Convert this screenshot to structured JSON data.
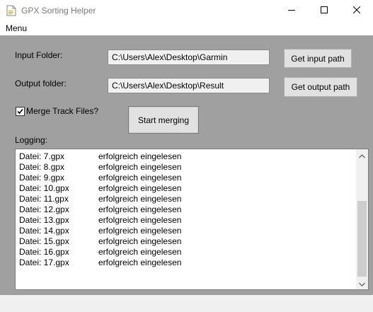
{
  "window": {
    "title": "GPX Sorting Helper"
  },
  "menubar": {
    "menu_label": "Menu"
  },
  "input": {
    "label": "Input Folder:",
    "value": "C:\\Users\\Alex\\Desktop\\Garmin",
    "button_label": "Get input path"
  },
  "output": {
    "label": "Output folder:",
    "value": "C:\\Users\\Alex\\Desktop\\Result",
    "button_label": "Get output path"
  },
  "merge": {
    "checkbox_label": "Merge Track Files?",
    "checked": true,
    "button_label": "Start merging"
  },
  "logging": {
    "label": "Logging:",
    "rows": [
      {
        "file": "Datei: 7.gpx",
        "status": "erfolgreich eingelesen"
      },
      {
        "file": "Datei: 8.gpx",
        "status": "erfolgreich eingelesen"
      },
      {
        "file": "Datei: 9.gpx",
        "status": "erfolgreich eingelesen"
      },
      {
        "file": "Datei: 10.gpx",
        "status": "erfolgreich eingelesen"
      },
      {
        "file": "Datei: 11.gpx",
        "status": "erfolgreich eingelesen"
      },
      {
        "file": "Datei: 12.gpx",
        "status": "erfolgreich eingelesen"
      },
      {
        "file": "Datei: 13.gpx",
        "status": "erfolgreich eingelesen"
      },
      {
        "file": "Datei: 14.gpx",
        "status": "erfolgreich eingelesen"
      },
      {
        "file": "Datei: 15.gpx",
        "status": "erfolgreich eingelesen"
      },
      {
        "file": "Datei: 16.gpx",
        "status": "erfolgreich eingelesen"
      },
      {
        "file": "Datei: 17.gpx",
        "status": "erfolgreich eingelesen"
      }
    ]
  },
  "icons": {
    "app": "document-icon",
    "minimize": "minimize-icon",
    "maximize": "maximize-icon",
    "close": "close-icon",
    "checkbox": "checkmark-icon",
    "scroll_up": "chevron-up-icon",
    "scroll_down": "chevron-down-icon"
  },
  "colors": {
    "background": "#a0a0a0",
    "titlebar": "#ffffff",
    "button": "#e1e1e1",
    "textbox": "#f0f0f0"
  }
}
